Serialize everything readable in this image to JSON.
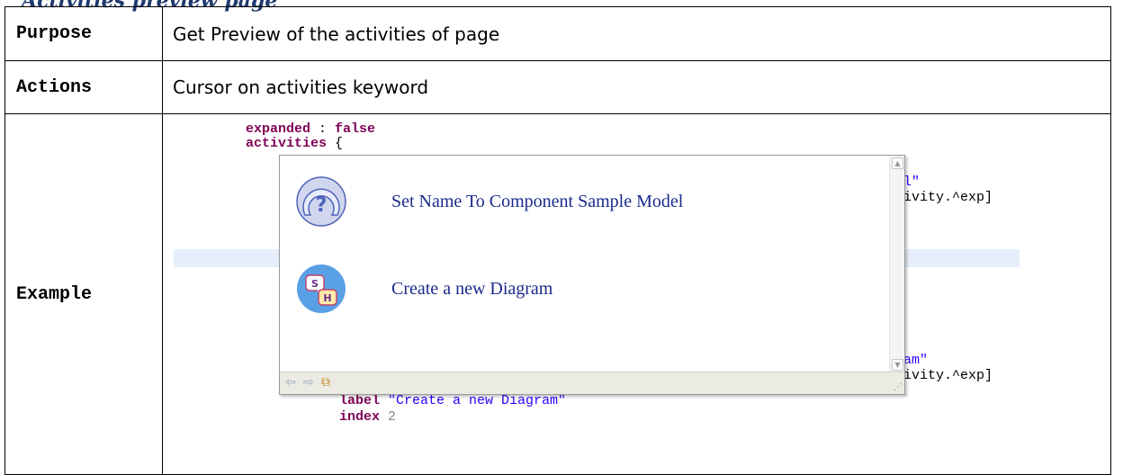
{
  "heading": "Activities preview page",
  "rows": {
    "purpose": {
      "label": "Purpose",
      "value": "Get Preview of the activities of page"
    },
    "actions": {
      "label": "Actions",
      "value": "Cursor on activities keyword"
    },
    "example": {
      "label": "Example"
    }
  },
  "editor": {
    "line1_kw": "expanded",
    "line1_rest": " : ",
    "line1_val": "false",
    "line2_kw": "activities",
    "line2_rest": " {",
    "frag_top_str": "l\"",
    "frag_top_code": "ivity.^exp]",
    "frag_bot_str": "am\"",
    "frag_bot_code": "ivity.^exp]",
    "line_label_kw": "label",
    "line_label_str": "\"Create a new Diagram\"",
    "line_index_kw": "index",
    "line_index_num": "2"
  },
  "popup": {
    "items": [
      {
        "label": "Set Name To Component Sample Model",
        "icon": "help-icon"
      },
      {
        "label": "Create a new Diagram",
        "icon": "diagram-icon"
      }
    ],
    "status": {
      "back_icon": "⇦",
      "forward_icon": "⇨",
      "open_icon": "⧉"
    }
  }
}
